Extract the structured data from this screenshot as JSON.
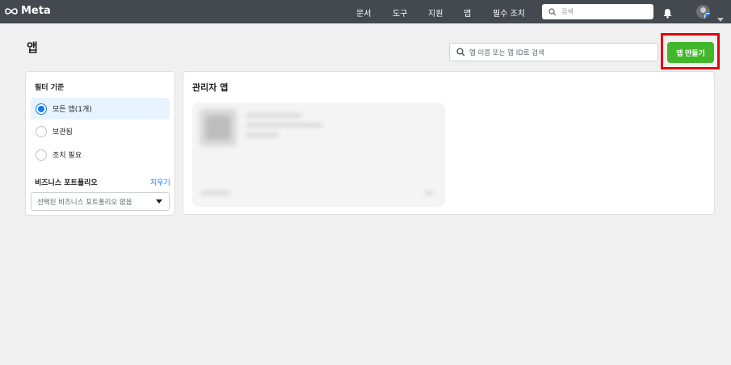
{
  "header": {
    "logo_text": "Meta",
    "nav": [
      "문서",
      "도구",
      "지원",
      "앱",
      "필수 조치"
    ],
    "search_placeholder": "검색"
  },
  "page": {
    "title": "앱",
    "search_placeholder": "앱 이름 또는 앱 ID로 검색",
    "create_button": "앱 만들기",
    "highlight_color": "#e8000b",
    "accent_color": "#42b72a"
  },
  "filter": {
    "title": "필터 기준",
    "options": [
      {
        "label": "모든 앱(1개)",
        "selected": true
      },
      {
        "label": "보관됨",
        "selected": false
      },
      {
        "label": "조치 필요",
        "selected": false
      }
    ],
    "business_portfolio": {
      "title": "비즈니스 포트폴리오",
      "clear": "지우기",
      "select_value": "선택된 비즈니스 포트폴리오 없음"
    }
  },
  "admin_apps": {
    "title": "관리자 앱"
  }
}
